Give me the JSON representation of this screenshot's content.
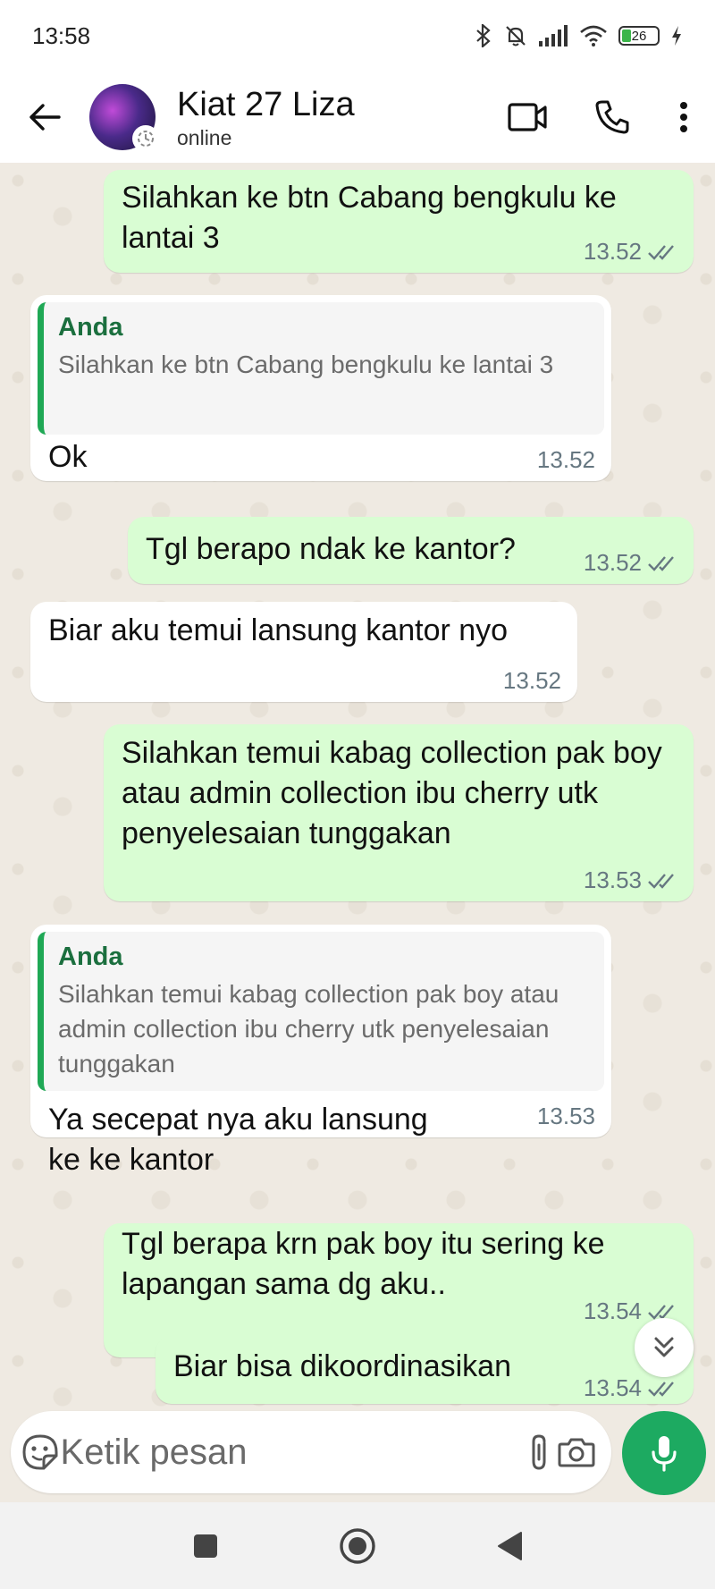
{
  "status_bar": {
    "time": "13:58",
    "battery_level": "26",
    "icons": [
      "bluetooth-icon",
      "bell-off-icon",
      "signal-icon",
      "wifi-icon",
      "battery-icon",
      "charging-icon"
    ]
  },
  "header": {
    "contact_name": "Kiat 27 Liza",
    "contact_status": "online",
    "actions": [
      "video-call-icon",
      "voice-call-icon",
      "more-options-icon"
    ]
  },
  "messages": [
    {
      "direction": "out",
      "text": "Silahkan ke btn Cabang bengkulu ke lantai 3",
      "time": "13.52",
      "ticks": "read"
    },
    {
      "direction": "in",
      "reply_author": "Anda",
      "reply_text": "Silahkan ke btn Cabang bengkulu ke lantai 3",
      "text": "Ok",
      "time": "13.52"
    },
    {
      "direction": "out",
      "text": "Tgl berapo ndak ke kantor?",
      "time": "13.52",
      "ticks": "read"
    },
    {
      "direction": "in",
      "text": "Biar aku temui lansung kantor nyo",
      "time": "13.52"
    },
    {
      "direction": "out",
      "text": "Silahkan temui kabag collection pak boy atau admin collection ibu cherry utk penyelesaian tunggakan",
      "time": "13.53",
      "ticks": "read"
    },
    {
      "direction": "in",
      "reply_author": "Anda",
      "reply_text": "Silahkan temui kabag collection pak boy atau admin collection ibu cherry utk penyelesaian tunggakan",
      "text": "Ya secepat nya aku lansung ke ke kantor",
      "time": "13.53"
    },
    {
      "direction": "out",
      "text": "Tgl berapa krn pak boy itu sering ke lapangan sama dg aku..",
      "time": "13.54",
      "ticks": "read"
    },
    {
      "direction": "out",
      "text": "Biar bisa dikoordinasikan",
      "time": "13.54",
      "ticks": "read"
    }
  ],
  "composer": {
    "placeholder": "Ketik pesan"
  },
  "colors": {
    "outgoing_bubble": "#d9fdd3",
    "incoming_bubble": "#ffffff",
    "accent_green": "#1daa61",
    "read_tick": "#667781",
    "chat_background": "#efeae2"
  }
}
